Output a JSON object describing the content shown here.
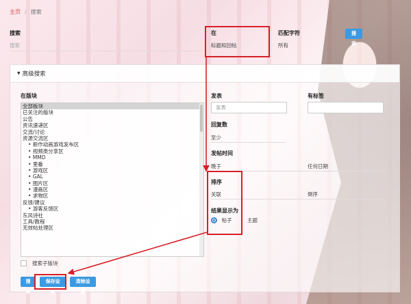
{
  "breadcrumb": {
    "home": "主页",
    "separator": "/",
    "current": "搜索"
  },
  "search": {
    "label": "搜索",
    "placeholder": "搜索",
    "button": "搜索"
  },
  "in_field": {
    "label": "在",
    "value": "标题和回帖"
  },
  "match": {
    "label": "匹配字符",
    "value": "所有"
  },
  "advanced": {
    "title": "高级搜索"
  },
  "forums": {
    "label": "在版块",
    "items": [
      {
        "label": "全部板块",
        "child": false,
        "selected": true
      },
      {
        "label": "已关注的版块",
        "child": false,
        "selected": false
      },
      {
        "label": "公告",
        "child": false,
        "selected": false
      },
      {
        "label": "资讯速递区",
        "child": false,
        "selected": false
      },
      {
        "label": "交流/讨论",
        "child": false,
        "selected": false
      },
      {
        "label": "资源交流区",
        "child": false,
        "selected": false
      },
      {
        "label": "新作动画游戏发布区",
        "child": true,
        "selected": false
      },
      {
        "label": "视频类分享区",
        "child": true,
        "selected": false
      },
      {
        "label": "MMD",
        "child": true,
        "selected": false
      },
      {
        "label": "里番",
        "child": true,
        "selected": false
      },
      {
        "label": "游戏区",
        "child": true,
        "selected": false
      },
      {
        "label": "GAL",
        "child": true,
        "selected": false
      },
      {
        "label": "图片区",
        "child": true,
        "selected": false
      },
      {
        "label": "漫画区",
        "child": true,
        "selected": false
      },
      {
        "label": "求物区",
        "child": true,
        "selected": false
      },
      {
        "label": "反馈/建议",
        "child": false,
        "selected": false
      },
      {
        "label": "游客反馈区",
        "child": true,
        "selected": false
      },
      {
        "label": "东风诗社",
        "child": false,
        "selected": false
      },
      {
        "label": "工具/教程",
        "child": false,
        "selected": false
      },
      {
        "label": "无效帖处理区",
        "child": false,
        "selected": false
      }
    ],
    "search_children": "搜索子版块"
  },
  "poster": {
    "label": "发表",
    "placeholder": "发表"
  },
  "tags": {
    "label": "有标签"
  },
  "replies": {
    "label": "回复数",
    "value": "至少"
  },
  "post_time": {
    "label": "发帖时间",
    "value": "晚于",
    "date": "任何日期"
  },
  "sort": {
    "label": "排序",
    "value": "关联",
    "order": "倒序"
  },
  "display": {
    "label": "结果显示为",
    "option_posts": "帖子",
    "option_topics": "主题"
  },
  "buttons": {
    "search": "搜索",
    "save": "保存设置",
    "clear": "清除设置"
  },
  "colors": {
    "accent": "#3b9ae1",
    "annotation": "#d61f26",
    "breadcrumb_home": "#d9534f"
  }
}
